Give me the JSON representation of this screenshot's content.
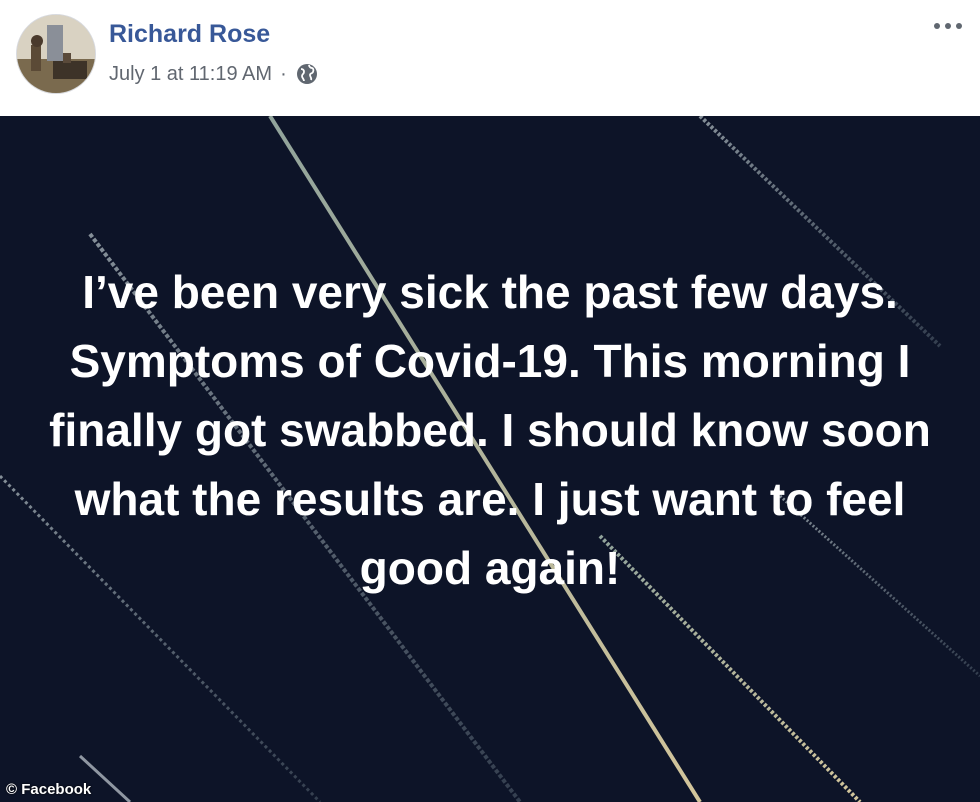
{
  "post": {
    "author": "Richard Rose",
    "timestamp": "July 1 at 11:19 AM",
    "separator": "·",
    "privacy_icon": "globe-icon",
    "more_icon": "more-options-icon",
    "status_text": "I’ve been very sick the past few days. Symptoms of Covid-19. This morning I finally got swabbed. I should know soon what the results are. I just want to feel good again!"
  },
  "credit": "© Facebook",
  "colors": {
    "author": "#385898",
    "meta": "#616770",
    "background": "#0d1428"
  }
}
